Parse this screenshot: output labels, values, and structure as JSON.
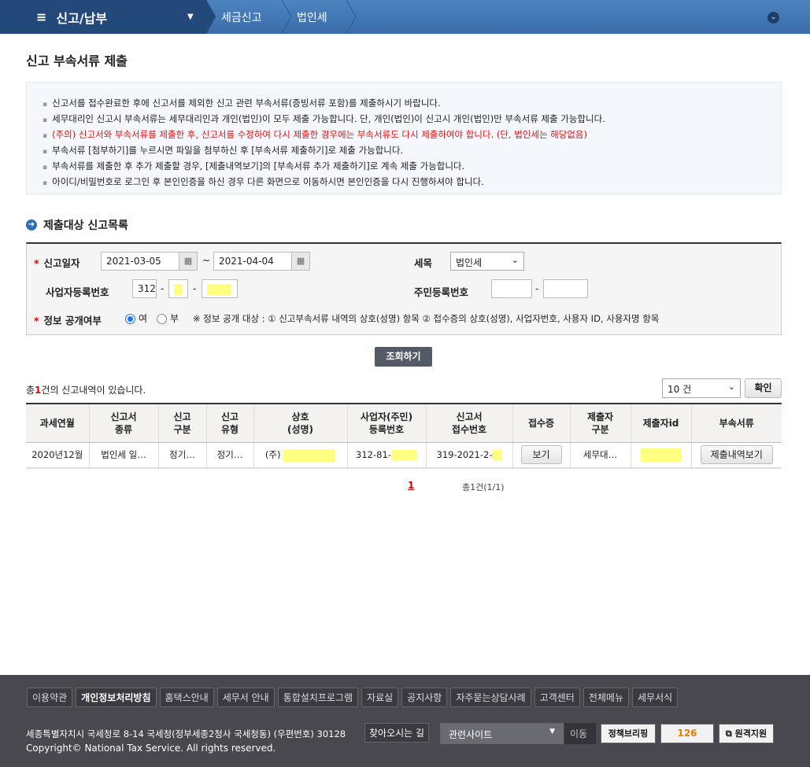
{
  "header": {
    "menu_title": "신고/납부",
    "breadcrumbs": [
      "세금신고",
      "법인세"
    ]
  },
  "page_title": "신고 부속서류 제출",
  "notices": [
    {
      "text": "신고서를 접수완료한 후에 신고서를 제외한 신고 관련 부속서류(증빙서류 포함)를 제출하시기 바랍니다.",
      "warning": false
    },
    {
      "text": "세무대리인 신고시 부속서류는 세무대리인과 개인(법인)이 모두 제출 가능합니다. 단, 개인(법인)이 신고시 개인(법인)만 부속서류 제출 가능합니다.",
      "warning": false
    },
    {
      "text": "(주의) 신고서와 부속서류를 제출한 후, 신고서를 수정하여 다시 제출한 경우에는 부속서류도 다시 제출하여야 합니다. (단, 법인세는 해당없음)",
      "warning": true
    },
    {
      "text": "부속서류 [첨부하기]를 누르시면 파일을 첨부하신 후 [부속서류 제출하기]로 제출 가능합니다.",
      "warning": false
    },
    {
      "text": "부속서류를 제출한 후 추가 제출할 경우, [제출내역보기]의 [부속서류 추가 제출하기]로 계속 제출 가능합니다.",
      "warning": false
    },
    {
      "text": "아이디/비밀번호로 로그인 후 본인인증을 하신 경우 다른 화면으로 이동하시면 본인인증을 다시 진행하셔야 합니다.",
      "warning": false
    }
  ],
  "section_title": "제출대상 신고목록",
  "search": {
    "date_label": "신고일자",
    "date_from": "2021-03-05",
    "date_to": "2021-04-04",
    "tilde": "~",
    "tax_label": "세목",
    "tax_value": "법인세",
    "bizno_label": "사업자등록번호",
    "bizno_1": "312",
    "dash": "-",
    "rrn_label": "주민등록번호",
    "disclose_label": "정보 공개여부",
    "yes": "여",
    "no": "부",
    "disclose_note": "※ 정보 공개 대상 : ① 신고부속서류 내역의 상호(성명) 항목 ② 접수증의 상호(성명), 사업자번호, 사용자 ID, 사용자명 항목",
    "search_button": "조회하기"
  },
  "result": {
    "count_prefix": "총",
    "count": "1",
    "count_suffix": "건의 신고내역이 있습니다.",
    "page_size": "10 건",
    "confirm": "확인"
  },
  "table": {
    "headers": [
      [
        "과세연월"
      ],
      [
        "신고서",
        "종류"
      ],
      [
        "신고",
        "구분"
      ],
      [
        "신고",
        "유형"
      ],
      [
        "상호",
        "(성명)"
      ],
      [
        "사업자(주민)",
        "등록번호"
      ],
      [
        "신고서",
        "접수번호"
      ],
      [
        "접수증"
      ],
      [
        "제출자",
        "구분"
      ],
      [
        "제출자id"
      ],
      [
        "부속서류"
      ]
    ],
    "rows": [
      {
        "period": "2020년12월",
        "type": "법인세 일…",
        "category": "정기…",
        "kind": "정기…",
        "name_prefix": "(주)",
        "bizno": "312-81-",
        "receipt_no": "319-2021-2-",
        "receipt_btn": "보기",
        "submitter_type": "세무대…",
        "docs_btn": "제출내역보기"
      }
    ]
  },
  "pagination": {
    "current": "1",
    "summary": "총1건(1/1)"
  },
  "footer": {
    "links": [
      "이용약관",
      "개인정보처리방침",
      "홈택스안내",
      "세무서 안내",
      "통합설치프로그램",
      "자료실",
      "공지사항",
      "자주묻는상담사례",
      "고객센터",
      "전체메뉴",
      "세무서식"
    ],
    "address": "세종특별자치시 국세청로 8-14 국세청(정부세종2청사 국세청동) (우편번호) 30128",
    "directions": "찾아오시는 길",
    "related": "관련사이트",
    "go": "이동",
    "policy": "정책브리핑",
    "remote": "원격지원",
    "hometax126": "126",
    "copyright": "Copyright© National Tax Service. All rights reserved."
  }
}
